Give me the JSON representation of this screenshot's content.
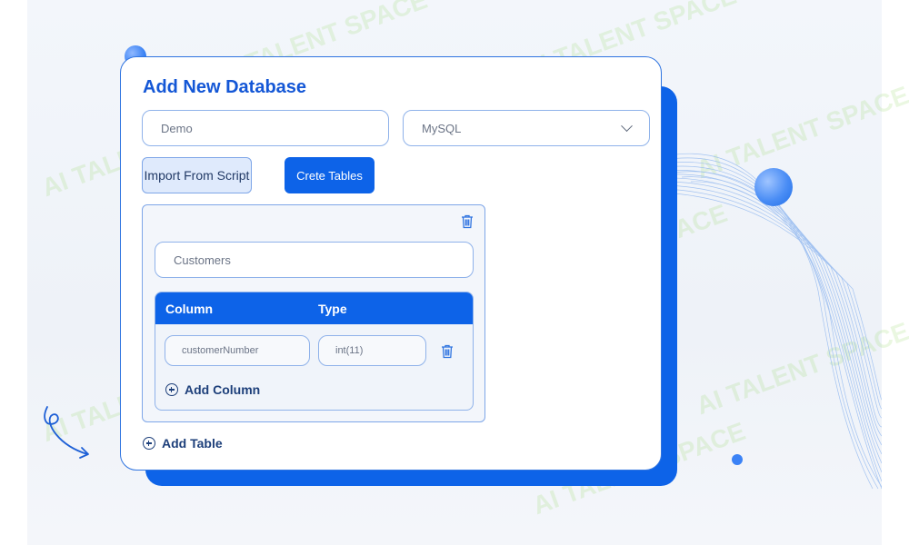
{
  "form": {
    "title": "Add New Database",
    "database_name": "Demo",
    "database_type": "MySQL",
    "import_button_label": "Import From Script",
    "create_button_label": "Crete Tables"
  },
  "table": {
    "name": "Customers",
    "column_header": "Column",
    "type_header": "Type",
    "columns": [
      {
        "name": "customerNumber",
        "type": "int(11)"
      }
    ],
    "add_column_label": "Add Column"
  },
  "add_table_label": "Add Table",
  "watermark": "AI TALENT SPACE",
  "colors": {
    "accent": "#0d63e8",
    "title": "#1457d6",
    "border": "#7ea6e8"
  },
  "icons": {
    "delete": "trash-icon",
    "add": "plus-circle-icon",
    "dropdown": "chevron-down-icon"
  }
}
